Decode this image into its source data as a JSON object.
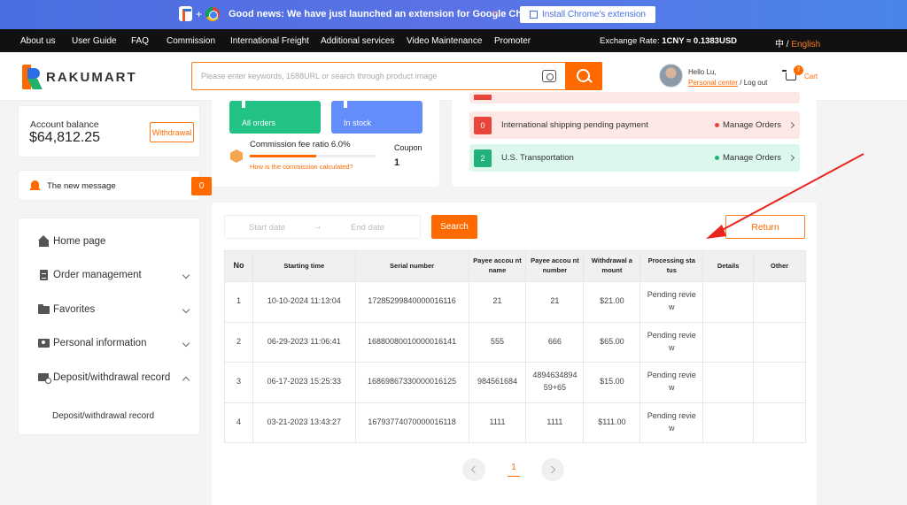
{
  "promo": {
    "news": "Good news: We have just launched an extension for Google Chrome",
    "install_label": "Install Chrome's extension"
  },
  "topnav": {
    "items": [
      "About us",
      "User Guide",
      "FAQ",
      "Commission",
      "International Freight",
      "Additional services",
      "Video Maintenance",
      "Promoter"
    ],
    "rate_label": "Exchange Rate: ",
    "rate_value": "1CNY ≈ 0.1383USD",
    "lang_zh": "中 / ",
    "lang_en": "English"
  },
  "header": {
    "logo_text": "RAKUMART",
    "search_placeholder": "Please enter keywords, 1688URL or search through product image",
    "hello": "Hello Lu,",
    "personal_center": "Personal center",
    "logout": " / Log out",
    "cart_count": "7",
    "cart_label": "Cart"
  },
  "balance": {
    "label": "Account balance",
    "amount": "$64,812.25",
    "withdrawal_label": "Withdrawal"
  },
  "new_message": {
    "label": "The new message",
    "count": "0"
  },
  "sidebar": {
    "items": [
      {
        "label": "Home page"
      },
      {
        "label": "Order management"
      },
      {
        "label": "Favorites"
      },
      {
        "label": "Personal information"
      },
      {
        "label": "Deposit/withdrawal record"
      }
    ],
    "sub_item": "Deposit/withdrawal record"
  },
  "summary": {
    "tile_all_orders": "All orders",
    "tile_in_stock": "In stock",
    "commission_ratio": "Commission fee ratio 6.0%",
    "commission_progress": 0.53,
    "commission_help": "How is the commission calculated?",
    "coupon_label": "Coupon",
    "coupon_value": "1"
  },
  "status_rows": [
    {
      "num": "0",
      "label": "International shipping pending payment",
      "action": "Manage Orders"
    },
    {
      "num": "2",
      "label": "U.S. Transportation",
      "action": "Manage Orders"
    }
  ],
  "filters": {
    "start_placeholder": "Start date",
    "arrow": "→",
    "end_placeholder": "End date",
    "search_label": "Search",
    "return_label": "Return"
  },
  "table": {
    "headers": [
      "No",
      "Starting time",
      "Serial number",
      "Payee accou nt name",
      "Payee accou nt number",
      "Withdrawal a mount",
      "Processing sta tus",
      "Details",
      "Other"
    ],
    "rows": [
      [
        "1",
        "10-10-2024 11:13:04",
        "17285299840000016116",
        "21",
        "21",
        "$21.00",
        "Pending revie w",
        "",
        ""
      ],
      [
        "2",
        "06-29-2023 11:06:41",
        "16880080010000016141",
        "555",
        "666",
        "$65.00",
        "Pending revie w",
        "",
        ""
      ],
      [
        "3",
        "06-17-2023 15:25:33",
        "16869867330000016125",
        "984561684",
        "4894634894 59+65",
        "$15.00",
        "Pending revie w",
        "",
        ""
      ],
      [
        "4",
        "03-21-2023 13:43:27",
        "16793774070000016118",
        "1111",
        "1111",
        "$111.00",
        "Pending revie w",
        "",
        ""
      ]
    ]
  },
  "pager": {
    "current": "1"
  },
  "colors": {
    "accent": "#ff6a00",
    "promo_blue": "#4a6fe0",
    "green_tile": "#21c283",
    "blue_tile": "#628dfb",
    "annotation_red": "#e8251f"
  }
}
